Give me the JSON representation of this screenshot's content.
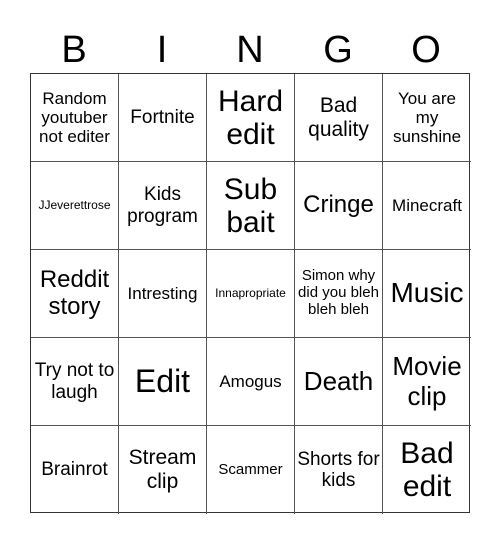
{
  "header": [
    "B",
    "I",
    "N",
    "G",
    "O"
  ],
  "cells": [
    "Random youtuber not editer",
    "Fortnite",
    "Hard edit",
    "Bad quality",
    "You are my sunshine",
    "JJeverettrose",
    "Kids program",
    "Sub bait",
    "Cringe",
    "Minecraft",
    "Reddit story",
    "Intresting",
    "Innapropriate",
    "Simon why did you bleh bleh bleh",
    "Music",
    "Try not to laugh",
    "Edit",
    "Amogus",
    "Death",
    "Movie clip",
    "Brainrot",
    "Stream clip",
    "Scammer",
    "Shorts for kids",
    "Bad edit"
  ]
}
